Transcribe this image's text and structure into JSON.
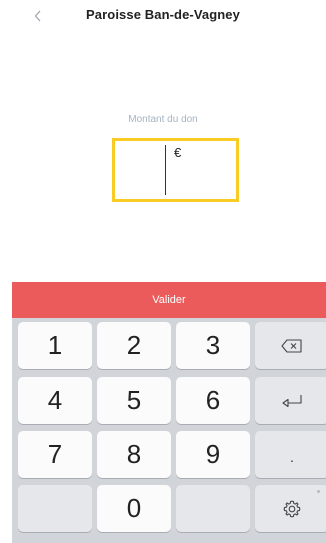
{
  "header": {
    "back_icon": "chevron-left-icon",
    "title": "Paroisse Ban-de-Vagney"
  },
  "donation": {
    "label": "Montant du don",
    "value": "",
    "currency": "€",
    "highlight_color": "#f8cc25"
  },
  "validate": {
    "label": "Valider",
    "color": "#ec5b5b"
  },
  "keypad": {
    "keys": [
      "1",
      "2",
      "3",
      "4",
      "5",
      "6",
      "7",
      "8",
      "9",
      "0"
    ],
    "decimal_label": ".",
    "backspace_icon": "backspace-icon",
    "return_icon": "return-icon",
    "settings_icon": "gear-icon"
  }
}
